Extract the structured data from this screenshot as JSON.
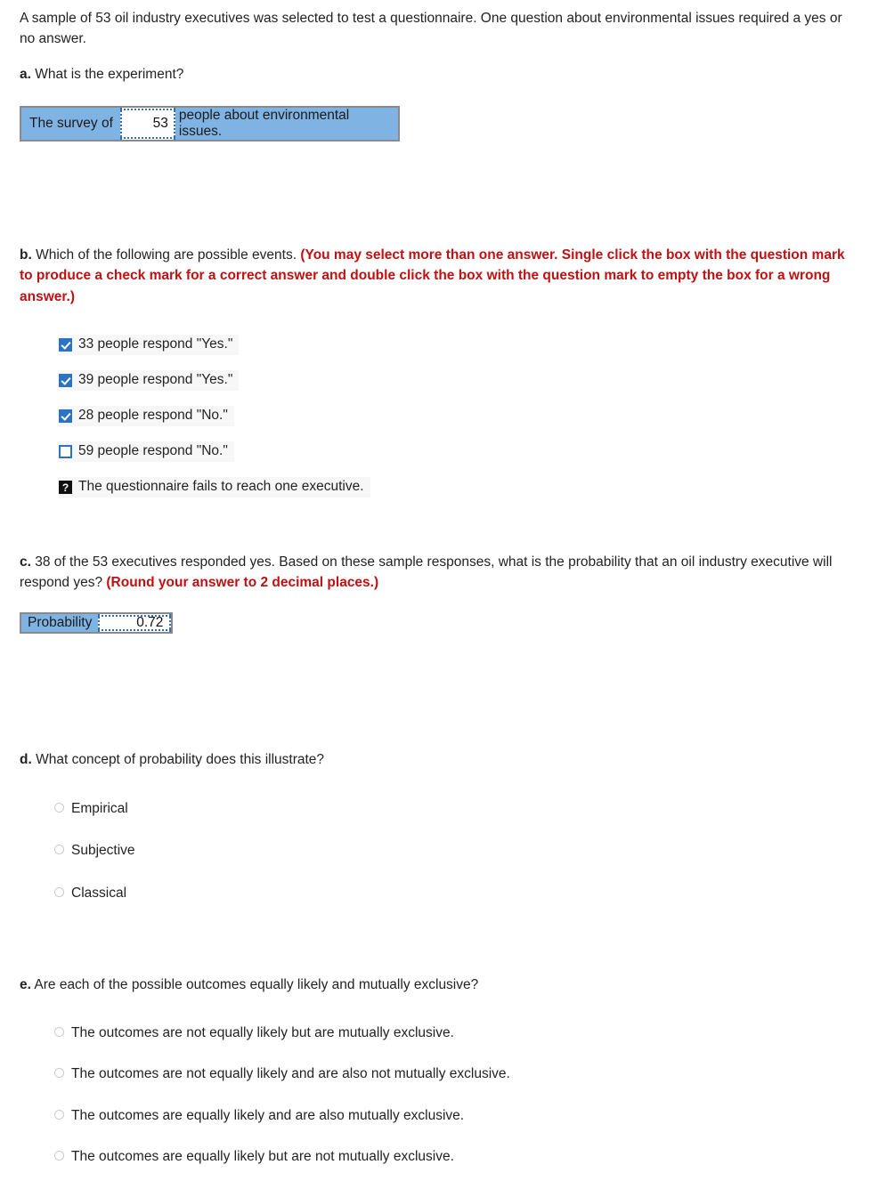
{
  "problem": {
    "intro": "A sample of 53 oil industry executives was selected to test a questionnaire. One question about environmental issues required a yes or no answer."
  },
  "part_a": {
    "label": "a.",
    "question": "What is the experiment?",
    "answer_box": {
      "prefix": "The survey of",
      "value": "53",
      "suffix": "people about environmental issues."
    }
  },
  "part_b": {
    "label": "b.",
    "question": "Which of the following are possible events.",
    "instruction": "(You may select more than one answer. Single click the box with the question mark to produce a check mark for a correct answer and double click the box with the question mark to empty the box for a wrong answer.)",
    "options": [
      {
        "state": "checked",
        "label": "33 people respond \"Yes.\""
      },
      {
        "state": "checked",
        "label": "39 people respond \"Yes.\""
      },
      {
        "state": "checked",
        "label": "28 people respond \"No.\""
      },
      {
        "state": "unchecked",
        "label": "59 people respond \"No.\""
      },
      {
        "state": "question",
        "glyph": "?",
        "label": "The questionnaire fails to reach one executive."
      }
    ]
  },
  "part_c": {
    "label": "c.",
    "question": "38 of the 53 executives responded yes. Based on these sample responses, what is the probability that an oil industry executive will respond yes?",
    "instruction": "(Round your answer to 2 decimal places.)",
    "answer_box": {
      "prefix": "Probability",
      "value": "0.72"
    }
  },
  "part_d": {
    "label": "d.",
    "question": "What concept of probability does this illustrate?",
    "options": [
      {
        "label": "Empirical",
        "selected": false
      },
      {
        "label": "Subjective",
        "selected": false
      },
      {
        "label": "Classical",
        "selected": false
      }
    ]
  },
  "part_e": {
    "label": "e.",
    "question": "Are each of the possible outcomes equally likely and mutually exclusive?",
    "options": [
      {
        "label": "The outcomes are not equally likely but are mutually exclusive.",
        "selected": false
      },
      {
        "label": "The outcomes are not equally likely and are also not mutually exclusive.",
        "selected": false
      },
      {
        "label": "The outcomes are equally likely and are also mutually exclusive.",
        "selected": false
      },
      {
        "label": "The outcomes are equally likely but are not mutually exclusive.",
        "selected": false
      }
    ]
  },
  "colors": {
    "answer_fill": "#7fb3e3",
    "answer_border": "#8a8a8a",
    "input_border": "#2f6fb5",
    "checkbox_blue": "#2b74c4",
    "instruction_red": "#bf1111",
    "row_background": "#f7f7f7",
    "radio_outline": "#cccccc",
    "question_box": "#111111"
  }
}
